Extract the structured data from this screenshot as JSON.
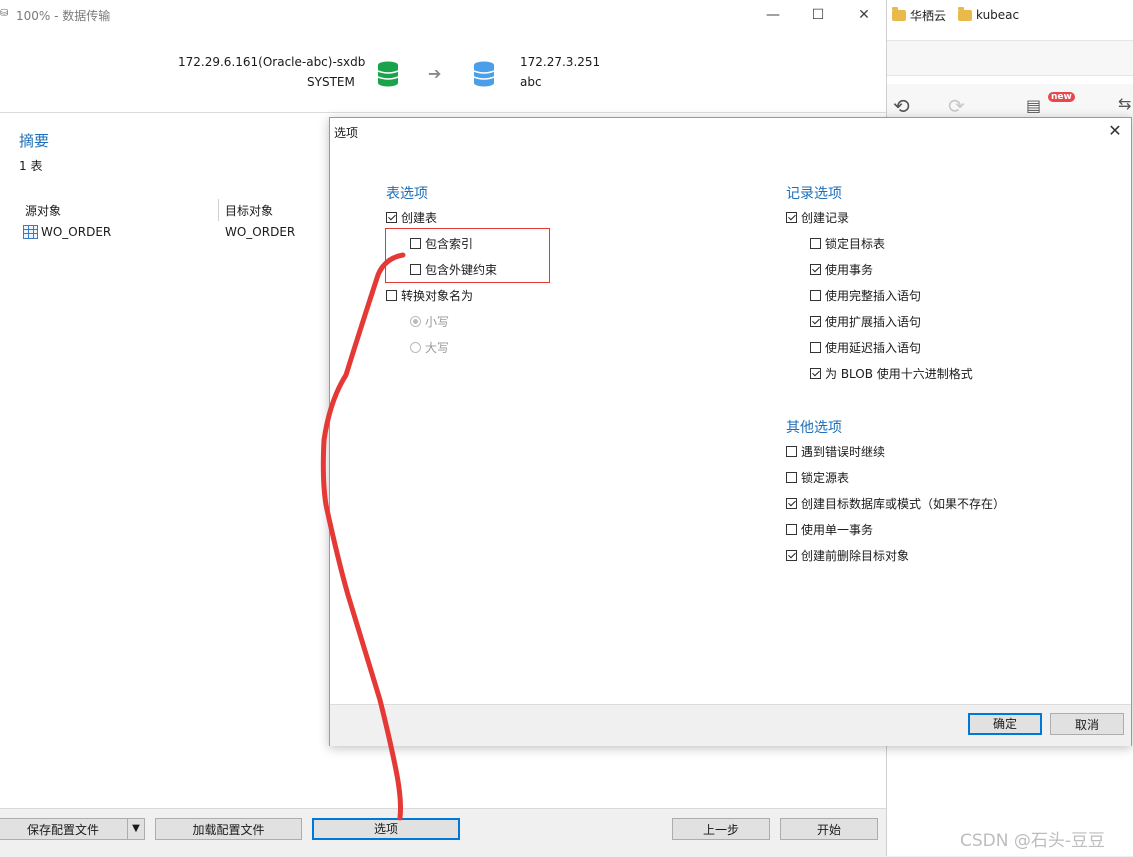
{
  "browser": {
    "bookmarks": [
      "华栖云",
      "kubeac"
    ],
    "new_badge": "new"
  },
  "window": {
    "title": "100% - 数据传输",
    "controls": {
      "minimize": "—",
      "maximize": "☐",
      "close": "✕"
    }
  },
  "connection": {
    "source_host": "172.29.6.161(Oracle-abc)-sxdb",
    "source_user": "SYSTEM",
    "target_host": "172.27.3.251",
    "target_db": "abc",
    "source_db_color": "#1aa34a",
    "target_db_color": "#4a9fe8"
  },
  "summary": {
    "title": "摘要",
    "count": "1 表",
    "col_source": "源对象",
    "col_target": "目标对象",
    "rows": [
      {
        "source": "WO_ORDER",
        "target": "WO_ORDER"
      }
    ]
  },
  "footer": {
    "save_config": "保存配置文件",
    "load_config": "加载配置文件",
    "options": "选项",
    "prev": "上一步",
    "start": "开始"
  },
  "dialog": {
    "title": "选项",
    "table_options": {
      "title": "表选项",
      "create_table": {
        "label": "创建表",
        "checked": true
      },
      "include_index": {
        "label": "包含索引",
        "checked": false
      },
      "include_fk": {
        "label": "包含外键约束",
        "checked": false
      },
      "convert_names": {
        "label": "转换对象名为",
        "checked": false
      },
      "lowercase": {
        "label": "小写",
        "selected": true
      },
      "uppercase": {
        "label": "大写",
        "selected": false
      }
    },
    "record_options": {
      "title": "记录选项",
      "items": [
        {
          "label": "创建记录",
          "checked": true
        },
        {
          "label": "锁定目标表",
          "checked": false
        },
        {
          "label": "使用事务",
          "checked": true
        },
        {
          "label": "使用完整插入语句",
          "checked": false
        },
        {
          "label": "使用扩展插入语句",
          "checked": true
        },
        {
          "label": "使用延迟插入语句",
          "checked": false
        },
        {
          "label": "为 BLOB 使用十六进制格式",
          "checked": true
        }
      ]
    },
    "other_options": {
      "title": "其他选项",
      "items": [
        {
          "label": "遇到错误时继续",
          "checked": false
        },
        {
          "label": "锁定源表",
          "checked": false
        },
        {
          "label": "创建目标数据库或模式（如果不存在）",
          "checked": true
        },
        {
          "label": "使用单一事务",
          "checked": false
        },
        {
          "label": "创建前删除目标对象",
          "checked": true
        }
      ]
    },
    "ok": "确定",
    "cancel": "取消"
  },
  "watermark": "CSDN @石头-豆豆",
  "annotation_color": "#e53935"
}
